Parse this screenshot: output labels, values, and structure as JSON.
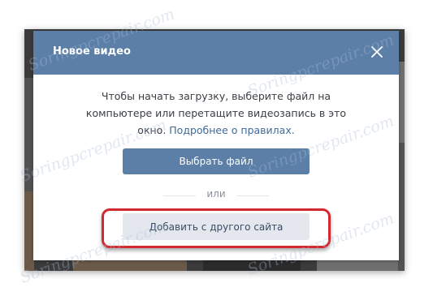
{
  "modal": {
    "title": "Новое видео",
    "close_icon": "close-icon",
    "instruction_text": "Чтобы начать загрузку, выберите файл на компьютере или перетащите видеозапись в это окно.",
    "rules_link": "Подробнее о правилах.",
    "choose_file_label": "Выбрать файл",
    "or_label": "или",
    "add_from_other_site_label": "Добавить с другого сайта"
  },
  "watermark": "Soringpcrepair.com",
  "colors": {
    "header": "#5b7fa6",
    "primary_button": "#5b7fa6",
    "secondary_button": "#e4e8ee",
    "link": "#3f6a98",
    "highlight": "#d2282f"
  }
}
